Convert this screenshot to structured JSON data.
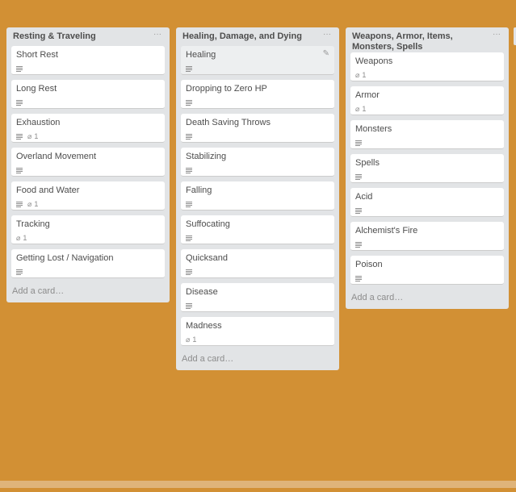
{
  "lists": [
    {
      "title": "Resting & Traveling",
      "menu": "···",
      "add_card": "Add a card…",
      "cards": [
        {
          "title": "Short Rest",
          "desc": true
        },
        {
          "title": "Long Rest",
          "desc": true
        },
        {
          "title": "Exhaustion",
          "desc": true,
          "attachments": "1"
        },
        {
          "title": "Overland Movement",
          "desc": true
        },
        {
          "title": "Food and Water",
          "desc": true,
          "attachments": "1"
        },
        {
          "title": "Tracking",
          "desc": false,
          "attachments": "1"
        },
        {
          "title": "Getting Lost / Navigation",
          "desc": true
        }
      ]
    },
    {
      "title": "Healing, Damage, and Dying",
      "menu": "···",
      "add_card": "Add a card…",
      "cards": [
        {
          "title": "Healing",
          "desc": true,
          "active": true
        },
        {
          "title": "Dropping to Zero HP",
          "desc": true
        },
        {
          "title": "Death Saving Throws",
          "desc": true
        },
        {
          "title": "Stabilizing",
          "desc": true
        },
        {
          "title": "Falling",
          "desc": true
        },
        {
          "title": "Suffocating",
          "desc": true
        },
        {
          "title": "Quicksand",
          "desc": true
        },
        {
          "title": "Disease",
          "desc": true
        },
        {
          "title": "Madness",
          "desc": false,
          "attachments": "1"
        }
      ]
    },
    {
      "title": "Weapons, Armor, Items, Monsters, Spells",
      "menu": "···",
      "add_card": "Add a card…",
      "cards": [
        {
          "title": "Weapons",
          "desc": false,
          "attachments": "1"
        },
        {
          "title": "Armor",
          "desc": false,
          "attachments": "1"
        },
        {
          "title": "Monsters",
          "desc": true
        },
        {
          "title": "Spells",
          "desc": true
        },
        {
          "title": "Acid",
          "desc": true
        },
        {
          "title": "Alchemist's Fire",
          "desc": true
        },
        {
          "title": "Poison",
          "desc": true
        }
      ]
    }
  ],
  "icons": {
    "description": "description-icon",
    "attachment": "paperclip-icon",
    "edit": "pencil-icon",
    "menu": "ellipsis-icon"
  },
  "colors": {
    "board_background": "#d29034",
    "list_background": "#e2e4e6",
    "card_background": "#ffffff"
  }
}
